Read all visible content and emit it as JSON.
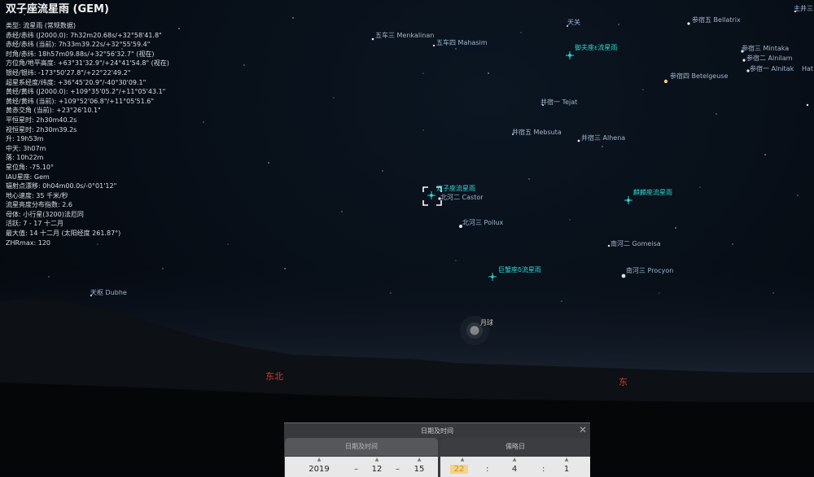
{
  "info": {
    "title": "双子座流星雨 (GEM)",
    "rows": [
      "类型: 流星雨 (常规数据)",
      "赤经/赤纬 (J2000.0): 7h32m20.68s/+32°58'41.8\"",
      "赤经/赤纬 (当前): 7h33m39.22s/+32°55'59.4\"",
      "时角/赤纬: 18h57m09.88s/+32°56'32.7\" (视在)",
      "方位角/地平高度: +63°31'32.9\"/+24°41'54.8\" (视在)",
      "银经/银纬: -173°50'27.8\"/+22°22'49.2\"",
      "超星系经度/纬度: +36°45'20.9\"/-40°30'09.1\"",
      "黄经/黄纬 (J2000.0): +109°35'05.2\"/+11°05'43.1\"",
      "黄经/黄纬 (当前): +109°52'06.8\"/+11°05'51.6\"",
      "黄赤交角 (当前): +23°26'10.1\"",
      "平恒星时: 2h30m40.2s",
      "视恒星时: 2h30m39.2s",
      "升: 19h53m",
      "中天: 3h07m",
      "落: 10h22m",
      "星位角: -75.10°",
      "IAU星座: Gem",
      "辐射点漂移: 0h04m00.0s/-0°01'12\"",
      "地心速度: 35 千米/秒",
      "流星亮度分布指数: 2.6",
      "母体: 小行星(3200)法厄同",
      "活跃: 7 - 17 十二月",
      "最大值: 14 十二月 (太阳经度 261.87°)",
      "ZHRmax: 120"
    ]
  },
  "labels": {
    "menkalinan": "五车三 Menkalinan",
    "mahasim": "五车四 Mahasim",
    "tianguan": "天关",
    "aurigids": "御夫座ε流星雨",
    "bellatrix": "参宿五 Bellatrix",
    "jingsan_top": "主井三",
    "mintaka": "参宿三 Mintaka",
    "alnilam": "参宿二 Alnilam",
    "alnitak": "参宿一 Alnitak",
    "hat": "Hat",
    "betelgeuse": "参宿四 Betelgeuse",
    "tejat": "井宿一 Tejat",
    "mebsuta": "井宿五 Mebsuta",
    "alhena": "井宿三 Alhena",
    "geminids": "双子座流星雨",
    "castor": "北河二 Castor",
    "monocerotids": "麒麟座流星雨",
    "pollux": "北河三 Pollux",
    "gomeisa": "南河二 Gomeisa",
    "cancrids": "巨蟹座δ流星雨",
    "procyon": "南河三 Procyon",
    "dubhe": "天枢 Dubhe",
    "moon": "月球",
    "northeast": "东北",
    "east": "东"
  },
  "dtpanel": {
    "title": "日期及时间",
    "close": "✕",
    "tab_date": "日期及时间",
    "tab_jd": "儒略日",
    "year": "2019",
    "month": "12",
    "day": "15",
    "hour": "22",
    "minute": "4",
    "second": "1",
    "dash": "–",
    "colon": ":",
    "up": "▲"
  },
  "colors": {
    "meteor": "#34d6d0",
    "cardinal": "#d33b26",
    "star_label": "#9fb6cc"
  }
}
